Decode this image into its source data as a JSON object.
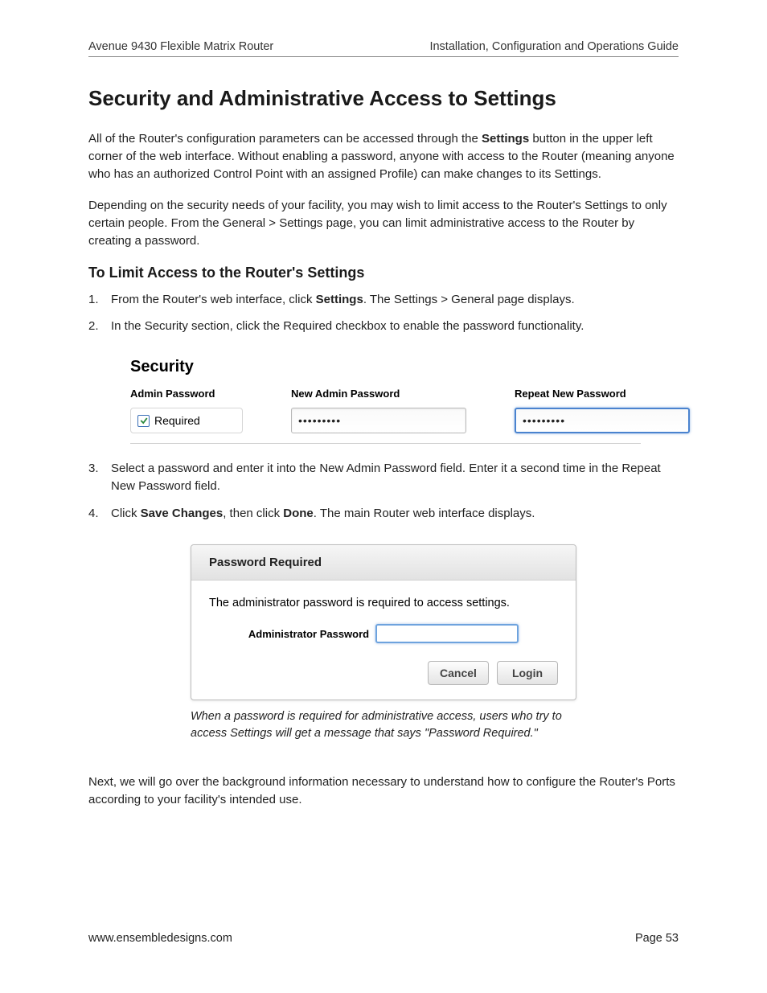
{
  "header": {
    "left": "Avenue 9430 Flexible Matrix Router",
    "right": "Installation, Configuration and Operations Guide"
  },
  "title": "Security and Administrative Access to Settings",
  "para1_a": "All of the Router's configuration parameters can be accessed through the ",
  "para1_bold": "Settings",
  "para1_b": " button in the upper left corner of the web interface. Without enabling a password, anyone with access to the Router (meaning anyone who has an authorized Control Point with an assigned Profile) can make changes to its Settings.",
  "para2": "Depending on the security needs of your facility, you may wish to limit access to the Router's Settings to only certain people. From the General > Settings page, you can limit administrative access to the Router by creating a password.",
  "subhead": "To Limit Access to the Router's Settings",
  "step1_a": "From the Router's web interface, click ",
  "step1_bold": "Settings",
  "step1_b": ". The Settings > General page displays.",
  "step2": "In the Security section, click the Required checkbox to enable the password functionality.",
  "security_shot": {
    "heading": "Security",
    "col1_label": "Admin Password",
    "col1_checkbox_label": "Required",
    "col1_checked": true,
    "col2_label": "New Admin Password",
    "col2_value": "•••••••••",
    "col3_label": "Repeat New Password",
    "col3_value": "•••••••••"
  },
  "step3": "Select a password and enter it into the New Admin Password field. Enter it a second time in the Repeat New Password field.",
  "step4_a": "Click ",
  "step4_bold1": "Save Changes",
  "step4_b": ", then click ",
  "step4_bold2": "Done",
  "step4_c": ". The main Router web interface displays.",
  "dialog": {
    "title": "Password Required",
    "message": "The administrator password is required to access settings.",
    "field_label": "Administrator Password",
    "cancel": "Cancel",
    "login": "Login"
  },
  "caption": "When a password is required for administrative access, users who try to access Settings will get a message that says \"Password Required.\"",
  "closing": "Next, we will go over the background information necessary to understand how to configure the Router's Ports according to your facility's intended use.",
  "footer": {
    "left": "www.ensembledesigns.com",
    "right": "Page 53"
  }
}
